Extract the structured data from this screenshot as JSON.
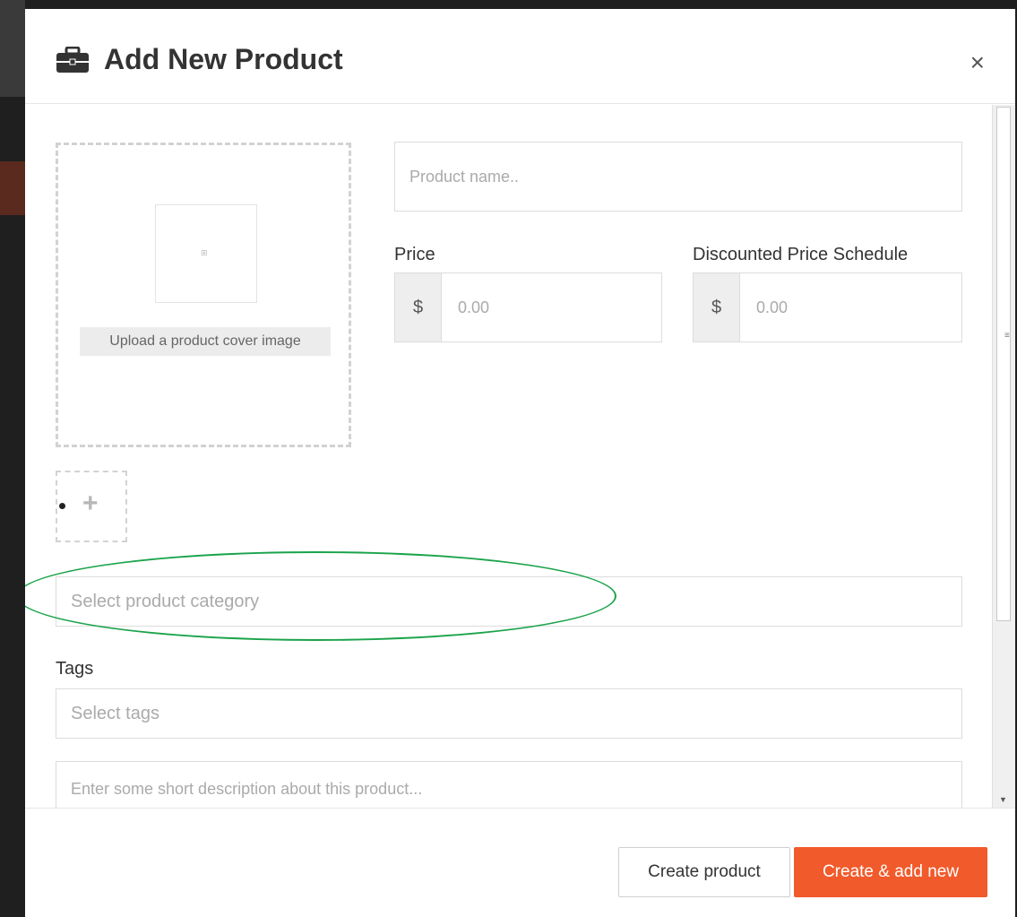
{
  "modal": {
    "title": "Add New Product",
    "title_icon": "briefcase-icon",
    "close_label": "×"
  },
  "cover": {
    "upload_label": "Upload a product cover image",
    "broken_image_glyph": "⊞"
  },
  "gallery": {
    "add_label": "+"
  },
  "form": {
    "name_placeholder": "Product name..",
    "price_label": "Price",
    "price_currency": "$",
    "price_placeholder": "0.00",
    "discount_label": "Discounted Price Schedule",
    "discount_currency": "$",
    "discount_placeholder": "0.00",
    "category_placeholder": "Select product category",
    "tags_label": "Tags",
    "tags_placeholder": "Select tags",
    "description_placeholder": "Enter some short description about this product..."
  },
  "footer": {
    "create_label": "Create product",
    "create_add_label": "Create & add new"
  },
  "colors": {
    "accent": "#f15a2b",
    "highlight": "#1aa34a"
  }
}
